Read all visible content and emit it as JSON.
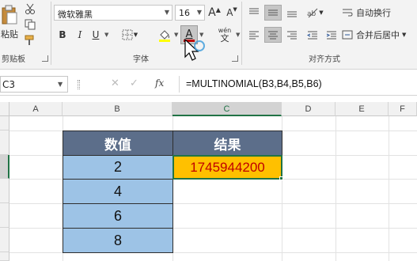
{
  "ribbon": {
    "clipboard": {
      "paste_label": "粘贴",
      "group_label": "剪贴板"
    },
    "font": {
      "font_name": "微软雅黑",
      "font_size": "16",
      "grow_label": "A",
      "shrink_label": "A",
      "bold_label": "B",
      "italic_label": "I",
      "underline_label": "U",
      "font_color_label": "A",
      "phonetic_label": "wén",
      "group_label": "字体",
      "font_color": "#c00000",
      "fill_color": "#ffff00"
    },
    "alignment": {
      "wrap_text_label": "自动换行",
      "merge_center_label": "合并后居中",
      "group_label": "对齐方式"
    }
  },
  "formula_bar": {
    "name_box": "C3",
    "fx_label": "fx",
    "formula": "=MULTINOMIAL(B3,B4,B5,B6)"
  },
  "sheet": {
    "columns": [
      "A",
      "B",
      "C",
      "D",
      "E",
      "F"
    ],
    "selected_column": "C",
    "table": {
      "headers": [
        "数值",
        "结果"
      ],
      "values": [
        "2",
        "4",
        "6",
        "8"
      ],
      "result": "1745944200"
    },
    "colors": {
      "header_bg": "#5c6e8a",
      "value_bg": "#9dc3e6",
      "result_bg": "#ffc000",
      "result_text": "#c00000",
      "selection": "#217346"
    }
  }
}
